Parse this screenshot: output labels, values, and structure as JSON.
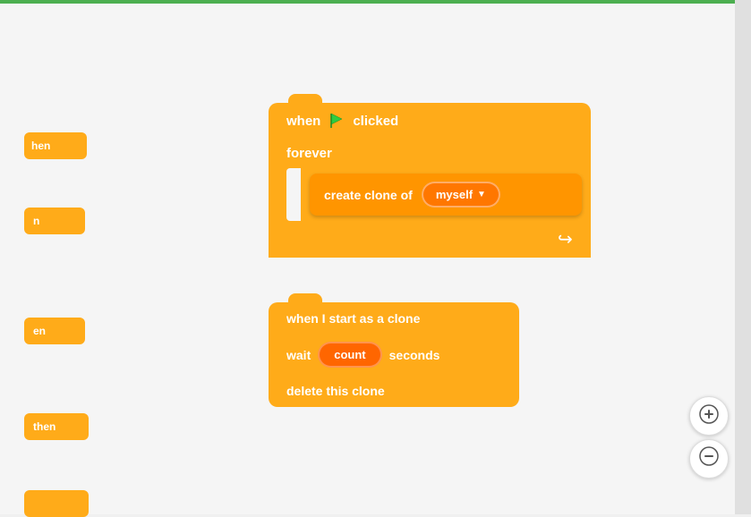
{
  "canvas": {
    "bg_color": "#f5f5f5",
    "top_border_color": "#4caf50"
  },
  "left_blocks": [
    {
      "id": "lb1",
      "label": "hen"
    },
    {
      "id": "lb2",
      "label": "n"
    },
    {
      "id": "lb3",
      "label": "en"
    },
    {
      "id": "lb4",
      "label": "then"
    },
    {
      "id": "lb5",
      "label": ""
    }
  ],
  "group1": {
    "hat_when": "when",
    "hat_clicked": "clicked",
    "forever_label": "forever",
    "create_clone_label": "create clone of",
    "myself_label": "myself"
  },
  "group2": {
    "hat_label": "when I start as a clone",
    "wait_label": "wait",
    "count_label": "count",
    "seconds_label": "seconds",
    "delete_label": "delete this clone"
  },
  "zoom": {
    "plus_symbol": "+",
    "minus_symbol": "−"
  }
}
